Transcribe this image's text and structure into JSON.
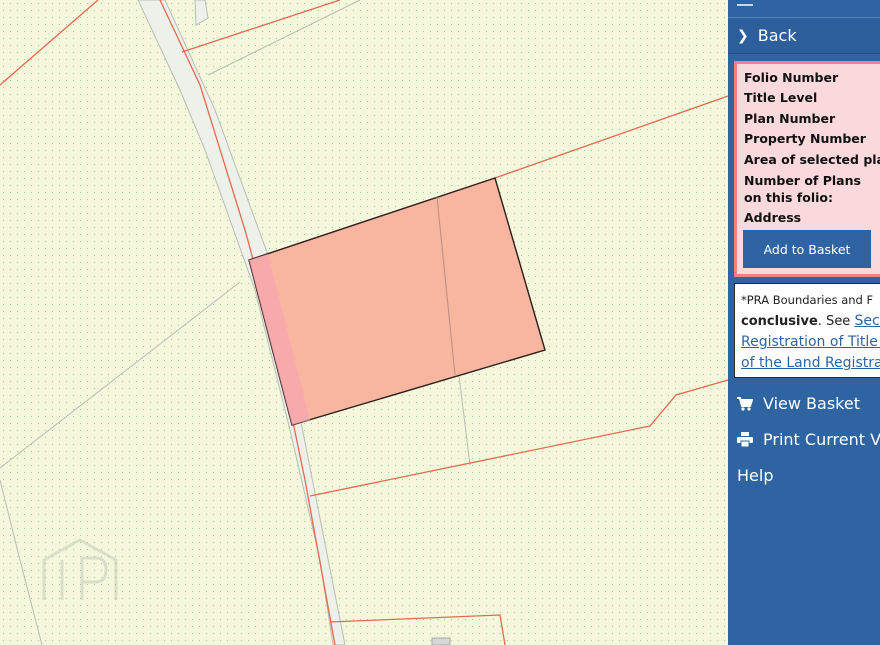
{
  "panel": {
    "back_label": "Back",
    "info_labels": {
      "folio_number": "Folio Number",
      "title_level": "Title Level",
      "plan_number": "Plan Number",
      "property_number": "Property Number",
      "area_selected_plans": "Area of selected plans",
      "number_of_plans": "Number of Plans on this folio:",
      "address": "Address"
    },
    "add_to_basket_label": "Add to Basket",
    "disclaimer": {
      "line1": "*PRA Boundaries and F",
      "bold_word": "conclusive",
      "after_bold": ". See ",
      "link_part1": "Sectio",
      "link_part2": "Registration of Title A",
      "link_part3": "of the Land Registra"
    },
    "menu": {
      "view_basket": "View Basket",
      "print_current_view": "Print Current View",
      "help": "Help"
    }
  },
  "colors": {
    "map_background": "#f5f7dc",
    "boundary_line": "#e46a4e",
    "selected_parcel_fill": "#f8b5a0",
    "panel_background": "#2f64a3",
    "info_box_background": "#fad9dc",
    "info_box_border": "#f37f89"
  }
}
